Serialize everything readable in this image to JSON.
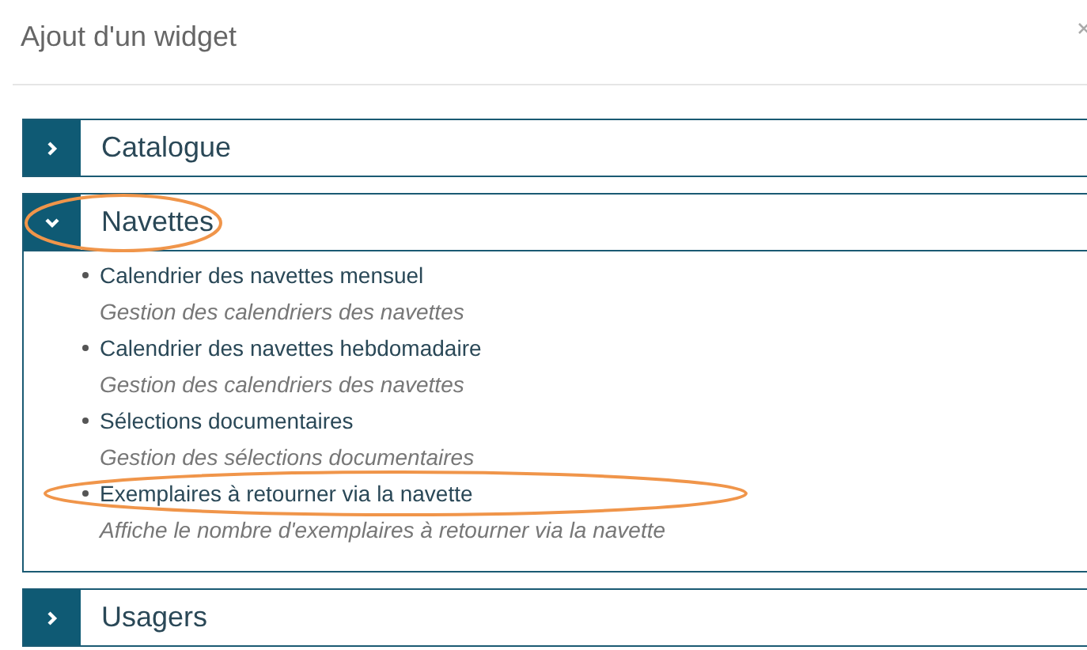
{
  "dialog": {
    "title": "Ajout d'un widget"
  },
  "sections": [
    {
      "label": "Catalogue",
      "expanded": false,
      "circled": false
    },
    {
      "label": "Navettes",
      "expanded": true,
      "circled": true,
      "items": [
        {
          "title": "Calendrier des navettes mensuel",
          "description": "Gestion des calendriers des navettes",
          "circled": false
        },
        {
          "title": "Calendrier des navettes hebdomadaire",
          "description": "Gestion des calendriers des navettes",
          "circled": false
        },
        {
          "title": "Sélections documentaires",
          "description": "Gestion des sélections documentaires",
          "circled": false
        },
        {
          "title": "Exemplaires à retourner via la navette",
          "description": "Affiche le nombre d'exemplaires à retourner via la navette",
          "circled": true
        }
      ]
    },
    {
      "label": "Usagers",
      "expanded": false,
      "circled": false
    }
  ]
}
